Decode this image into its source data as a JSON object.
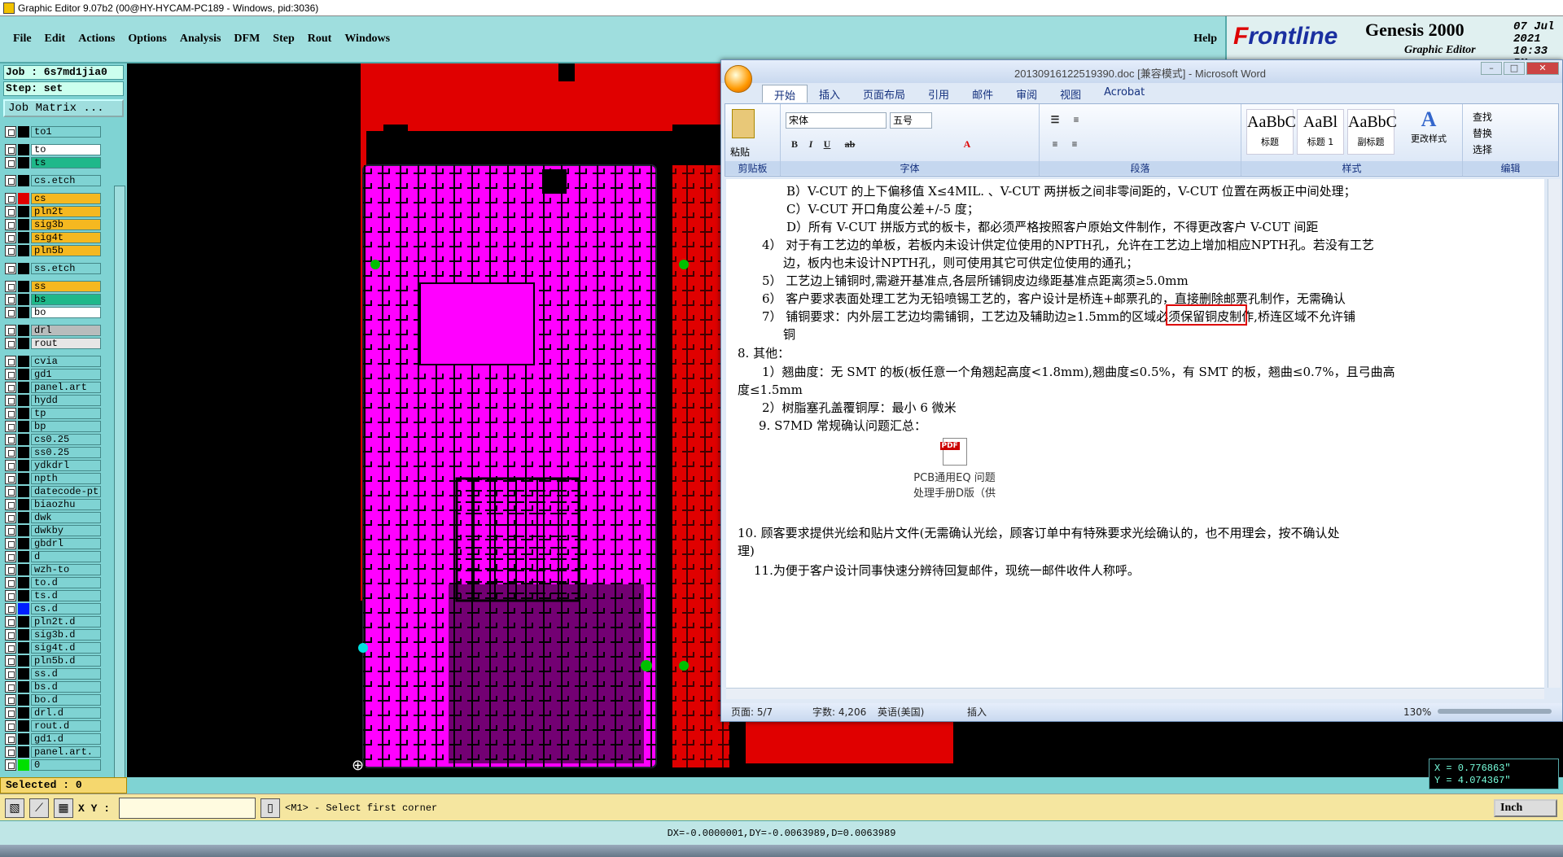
{
  "ge": {
    "title": "Graphic Editor 9.07b2 (00@HY-HYCAM-PC189 - Windows, pid:3036)",
    "menu": [
      "File",
      "Edit",
      "Actions",
      "Options",
      "Analysis",
      "DFM",
      "Step",
      "Rout",
      "Windows"
    ],
    "help": "Help",
    "brand": {
      "logo_f": "F",
      "logo_rest": "rontline",
      "product": "Genesis 2000",
      "subtitle": "Graphic Editor",
      "date": "07 Jul 2021",
      "time": "10:33 PM"
    },
    "job": "Job : 6s7md1jia0",
    "step": "Step: set",
    "job_matrix": "Job Matrix ...",
    "layers": [
      {
        "name": "to1",
        "color": "#7fd3d3",
        "swatch": "#000"
      },
      {
        "gap": true
      },
      {
        "name": "to",
        "color": "#ffffff",
        "swatch": "#000"
      },
      {
        "name": "ts",
        "color": "#1fb88a",
        "swatch": "#000"
      },
      {
        "gap": true
      },
      {
        "name": "cs.etch",
        "color": "#7fd3d3",
        "swatch": "#000"
      },
      {
        "gap": true
      },
      {
        "name": "cs",
        "color": "#f5b820",
        "swatch": "#e00000",
        "active": true
      },
      {
        "name": "pln2t",
        "color": "#f5b820",
        "swatch": "#000"
      },
      {
        "name": "sig3b",
        "color": "#f5b820",
        "swatch": "#000"
      },
      {
        "name": "sig4t",
        "color": "#f5b820",
        "swatch": "#000"
      },
      {
        "name": "pln5b",
        "color": "#f5b820",
        "swatch": "#000"
      },
      {
        "gap": true
      },
      {
        "name": "ss.etch",
        "color": "#7fd3d3",
        "swatch": "#000"
      },
      {
        "gap": true
      },
      {
        "name": "ss",
        "color": "#f5b820",
        "swatch": "#000"
      },
      {
        "name": "bs",
        "color": "#1fb88a",
        "swatch": "#000"
      },
      {
        "name": "bo",
        "color": "#ffffff",
        "swatch": "#000"
      },
      {
        "gap": true
      },
      {
        "name": "drl",
        "color": "#b8bcbc",
        "swatch": "#000"
      },
      {
        "name": "rout",
        "color": "#e6e6e6",
        "swatch": "#000"
      },
      {
        "gap": true
      },
      {
        "name": "cvia",
        "color": "#7fd3d3",
        "swatch": "#000"
      },
      {
        "name": "gd1",
        "color": "#7fd3d3",
        "swatch": "#000"
      },
      {
        "name": "panel.art",
        "color": "#7fd3d3",
        "swatch": "#000"
      },
      {
        "name": "hydd",
        "color": "#7fd3d3",
        "swatch": "#000"
      },
      {
        "name": "tp",
        "color": "#7fd3d3",
        "swatch": "#000"
      },
      {
        "name": "bp",
        "color": "#7fd3d3",
        "swatch": "#000"
      },
      {
        "name": "cs0.25",
        "color": "#7fd3d3",
        "swatch": "#000"
      },
      {
        "name": "ss0.25",
        "color": "#7fd3d3",
        "swatch": "#000"
      },
      {
        "name": "ydkdrl",
        "color": "#7fd3d3",
        "swatch": "#000"
      },
      {
        "name": "npth",
        "color": "#7fd3d3",
        "swatch": "#000"
      },
      {
        "name": "datecode-pt",
        "color": "#7fd3d3",
        "swatch": "#000"
      },
      {
        "name": "biaozhu",
        "color": "#7fd3d3",
        "swatch": "#000"
      },
      {
        "name": "dwk",
        "color": "#7fd3d3",
        "swatch": "#000"
      },
      {
        "name": "dwkby",
        "color": "#7fd3d3",
        "swatch": "#000"
      },
      {
        "name": "gbdrl",
        "color": "#7fd3d3",
        "swatch": "#000"
      },
      {
        "name": "d",
        "color": "#7fd3d3",
        "swatch": "#000"
      },
      {
        "name": "wzh-to",
        "color": "#7fd3d3",
        "swatch": "#000"
      },
      {
        "name": "to.d",
        "color": "#7fd3d3",
        "swatch": "#000"
      },
      {
        "name": "ts.d",
        "color": "#7fd3d3",
        "swatch": "#000"
      },
      {
        "name": "cs.d",
        "color": "#7fd3d3",
        "swatch": "#0020ff"
      },
      {
        "name": "pln2t.d",
        "color": "#7fd3d3",
        "swatch": "#000"
      },
      {
        "name": "sig3b.d",
        "color": "#7fd3d3",
        "swatch": "#000"
      },
      {
        "name": "sig4t.d",
        "color": "#7fd3d3",
        "swatch": "#000"
      },
      {
        "name": "pln5b.d",
        "color": "#7fd3d3",
        "swatch": "#000"
      },
      {
        "name": "ss.d",
        "color": "#7fd3d3",
        "swatch": "#000"
      },
      {
        "name": "bs.d",
        "color": "#7fd3d3",
        "swatch": "#000"
      },
      {
        "name": "bo.d",
        "color": "#7fd3d3",
        "swatch": "#000"
      },
      {
        "name": "drl.d",
        "color": "#7fd3d3",
        "swatch": "#000"
      },
      {
        "name": "rout.d",
        "color": "#7fd3d3",
        "swatch": "#000"
      },
      {
        "name": "gd1.d",
        "color": "#7fd3d3",
        "swatch": "#000"
      },
      {
        "name": "panel.art.",
        "color": "#7fd3d3",
        "swatch": "#000"
      },
      {
        "name": "0",
        "color": "#7fd3d3",
        "swatch": "#00e000"
      }
    ],
    "selected": "Selected : 0",
    "xy_label": "X Y :",
    "prompt": "<M1> - Select first corner",
    "units": "Inch",
    "coord_x": "X = 0.776863\"",
    "coord_y": "Y = 4.074367\"",
    "status": "DX=-0.0000001,DY=-0.0063989,D=0.0063989"
  },
  "word": {
    "title": "20130916122519390.doc [兼容模式] - Microsoft Word",
    "tabs": [
      "开始",
      "插入",
      "页面布局",
      "引用",
      "邮件",
      "审阅",
      "视图",
      "Acrobat"
    ],
    "groups": {
      "clipboard": "剪贴板",
      "font": "字体",
      "paragraph": "段落",
      "styles": "样式",
      "edit": "编辑"
    },
    "paste": "粘贴",
    "font_name": "宋体",
    "font_size": "五号",
    "styles": [
      {
        "sample": "AaBbC",
        "name": "标题"
      },
      {
        "sample": "AaBl",
        "name": "标题 1"
      },
      {
        "sample": "AaBbC",
        "name": "副标题"
      }
    ],
    "change_styles": "更改样式",
    "edit_items": [
      "查找",
      "替换",
      "选择"
    ],
    "doc_lines": [
      "B）V-CUT 的上下偏移值 X≤4MIL. 、V-CUT 两拼板之间非零间距的，V-CUT 位置在两板正中间处理；",
      "C）V-CUT 开口角度公差+/-5 度；",
      "D）所有 V-CUT 拼版方式的板卡，都必须严格按照客户原始文件制作，不得更改客户 V-CUT 间距",
      "4） 对于有工艺边的单板，若板内未设计供定位使用的NPTH孔，允许在工艺边上增加相应NPTH孔。若没有工艺",
      "边，板内也未设计NPTH孔，则可使用其它可供定位使用的通孔；",
      "5） 工艺边上铺铜时,需避开基准点,各层所铺铜皮边缘距基准点距离须≥5.0mm",
      "6） 客户要求表面处理工艺为无铅喷锡工艺的，客户设计是桥连+邮票孔的，直接删除邮票孔制作，无需确认",
      "7） 铺铜要求：内外层工艺边均需铺铜，工艺边及辅助边≥1.5mm的区域必须保留铜皮制作,桥连区域不允许铺",
      "铜",
      "8.  其他：",
      "1）翘曲度：无 SMT 的板(板任意一个角翘起高度<1.8mm),翘曲度≤0.5%，有 SMT 的板，翘曲≤0.7%，且弓曲高",
      "度≤1.5mm",
      "2）树脂塞孔盖覆铜厚：最小 6 微米",
      "9.  S7MD 常规确认问题汇总：",
      "10.  顾客要求提供光绘和贴片文件(无需确认光绘，顾客订单中有特殊要求光绘确认的，也不用理会，按不确认处",
      "理)",
      "11.为便于客户设计同事快速分辨待回复邮件，现统一邮件收件人称呼。"
    ],
    "attachment": [
      "PCB通用EQ 问题",
      "处理手册D版（供"
    ],
    "pdf_label": "PDF",
    "status": {
      "page": "页面: 5/7",
      "words": "字数: 4,206",
      "lang": "英语(美国)",
      "mode": "插入",
      "zoom": "130%"
    }
  }
}
